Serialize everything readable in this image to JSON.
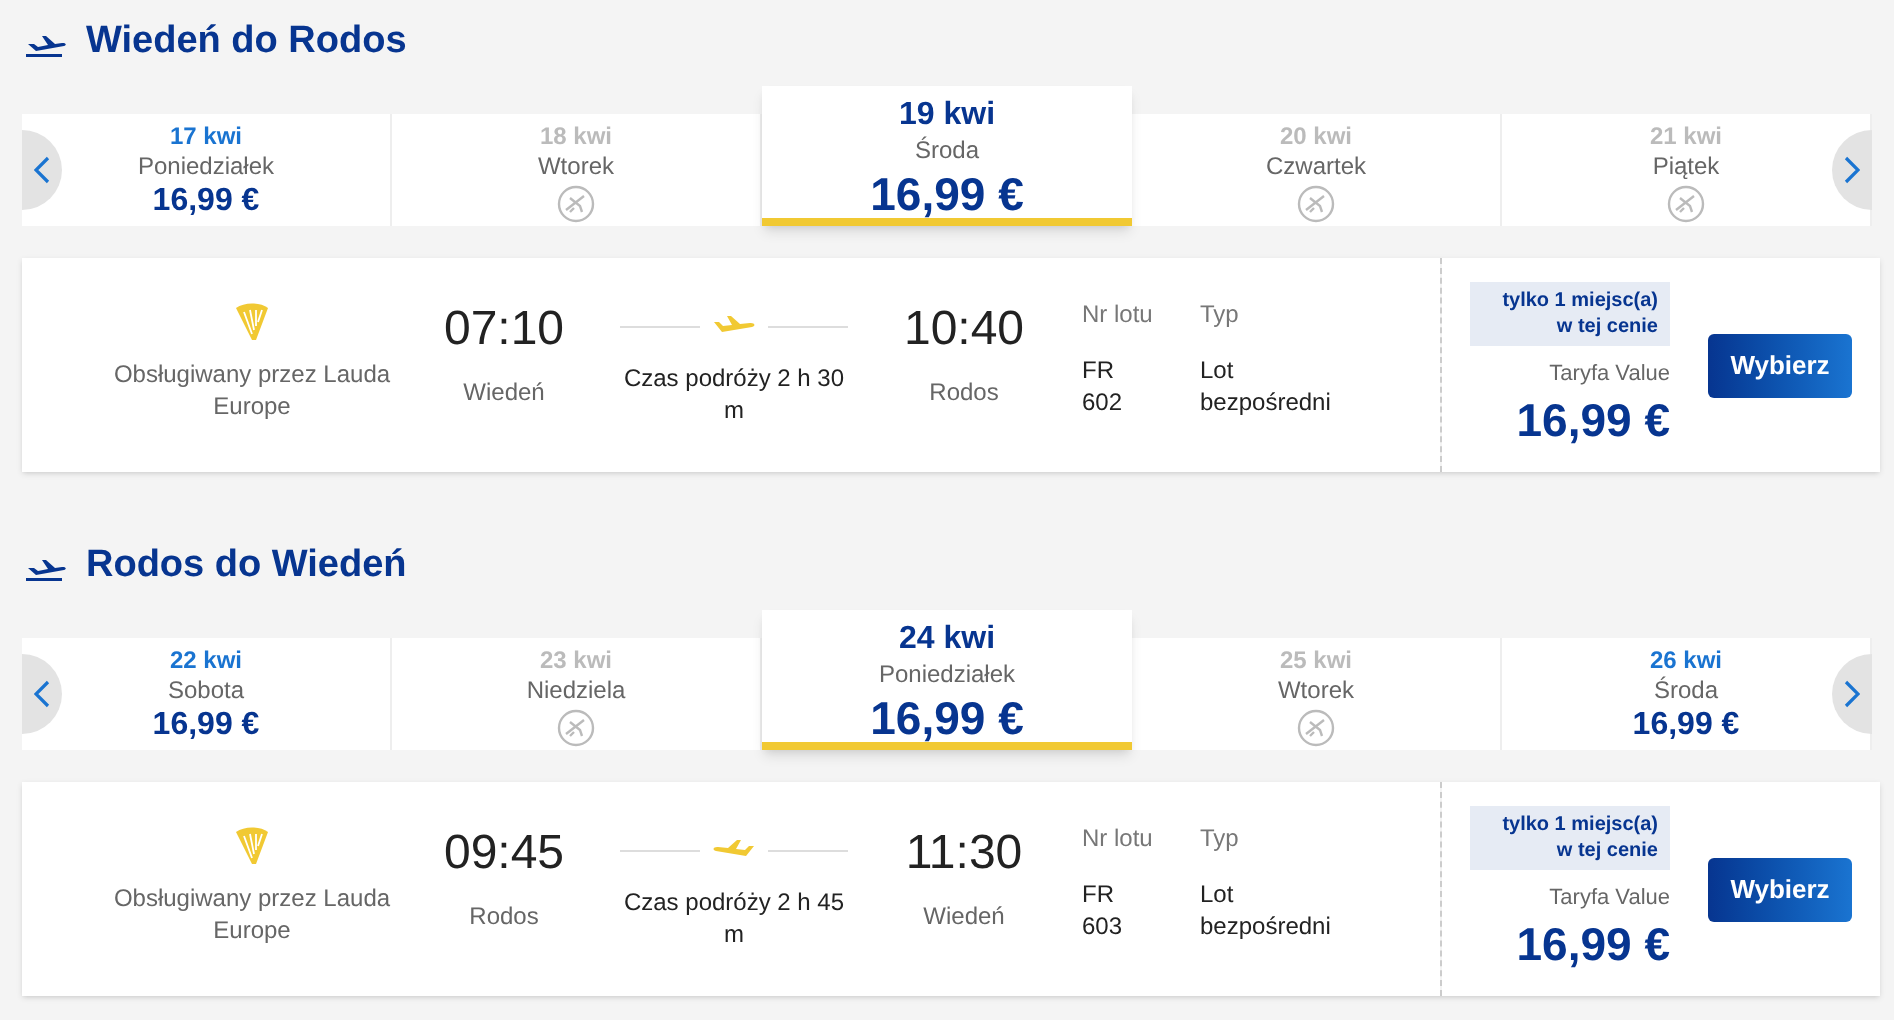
{
  "sections": [
    {
      "title": "Wiedeń do Rodos",
      "dates": [
        {
          "date": "17 kwi",
          "day": "Poniedziałek",
          "price": "16,99 €",
          "available": true,
          "selected": false
        },
        {
          "date": "18 kwi",
          "day": "Wtorek",
          "available": false,
          "selected": false
        },
        {
          "date": "19 kwi",
          "day": "Środa",
          "price": "16,99 €",
          "available": true,
          "selected": true
        },
        {
          "date": "20 kwi",
          "day": "Czwartek",
          "available": false,
          "selected": false
        },
        {
          "date": "21 kwi",
          "day": "Piątek",
          "available": false,
          "selected": false
        }
      ],
      "flight": {
        "operator": "Obsługiwany przez Lauda Europe",
        "departure_time": "07:10",
        "departure_city": "Wiedeń",
        "duration": "Czas podróży 2 h 30 m",
        "plane_reversed": false,
        "arrival_time": "10:40",
        "arrival_city": "Rodos",
        "flight_no_label": "Nr lotu",
        "flight_no": "FR 602",
        "type_label": "Typ",
        "type": "Lot bezpośredni",
        "seats_badge": "tylko 1 miejsc(a) w tej cenie",
        "fare": "Taryfa Value",
        "price": "16,99 €",
        "button": "Wybierz"
      }
    },
    {
      "title": "Rodos do Wiedeń",
      "dates": [
        {
          "date": "22 kwi",
          "day": "Sobota",
          "price": "16,99 €",
          "available": true,
          "selected": false
        },
        {
          "date": "23 kwi",
          "day": "Niedziela",
          "available": false,
          "selected": false
        },
        {
          "date": "24 kwi",
          "day": "Poniedziałek",
          "price": "16,99 €",
          "available": true,
          "selected": true
        },
        {
          "date": "25 kwi",
          "day": "Wtorek",
          "available": false,
          "selected": false
        },
        {
          "date": "26 kwi",
          "day": "Środa",
          "price": "16,99 €",
          "available": true,
          "selected": false
        }
      ],
      "flight": {
        "operator": "Obsługiwany przez Lauda Europe",
        "departure_time": "09:45",
        "departure_city": "Rodos",
        "duration": "Czas podróży 2 h 45 m",
        "plane_reversed": true,
        "arrival_time": "11:30",
        "arrival_city": "Wiedeń",
        "flight_no_label": "Nr lotu",
        "flight_no": "FR 603",
        "type_label": "Typ",
        "type": "Lot bezpośredni",
        "seats_badge": "tylko 1 miejsc(a) w tej cenie",
        "fare": "Taryfa Value",
        "price": "16,99 €",
        "button": "Wybierz"
      }
    }
  ]
}
